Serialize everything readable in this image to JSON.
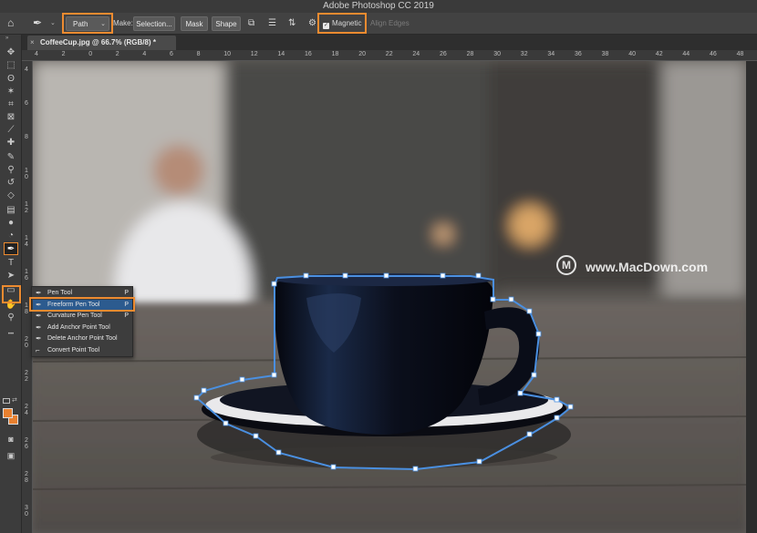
{
  "app": {
    "title": "Adobe Photoshop CC 2019"
  },
  "options_bar": {
    "mode_selected": "Path",
    "make_label": "Make:",
    "selection_button": "Selection...",
    "mask_button": "Mask",
    "shape_button": "Shape",
    "magnetic_label": "Magnetic",
    "magnetic_checked": true,
    "align_edges_label": "Align Edges",
    "highlight_color": "#ed8b30"
  },
  "document_tab": {
    "close_glyph": "×",
    "name": "CoffeeCup.jpg @ 66.7% (RGB/8) *"
  },
  "ruler": {
    "horizontal": [
      "4",
      "2",
      "0",
      "2",
      "4",
      "6",
      "8",
      "10",
      "12",
      "14",
      "16",
      "18",
      "20",
      "22",
      "24",
      "26",
      "28",
      "30",
      "32",
      "34",
      "36",
      "38",
      "40",
      "42",
      "44",
      "46",
      "48",
      "50"
    ],
    "vertical": [
      "4",
      "6",
      "8",
      "1\n0",
      "1\n2",
      "1\n4",
      "1\n6",
      "1\n8",
      "2\n0",
      "2\n2",
      "2\n4",
      "2\n6",
      "2\n8",
      "3\n0"
    ]
  },
  "toolbar": {
    "tools": [
      {
        "name": "move-tool",
        "glyph": "✥"
      },
      {
        "name": "marquee-tool",
        "glyph": "⬚"
      },
      {
        "name": "lasso-tool",
        "glyph": "ʘ"
      },
      {
        "name": "magic-wand-tool",
        "glyph": "✶"
      },
      {
        "name": "crop-tool",
        "glyph": "⌗"
      },
      {
        "name": "frame-tool",
        "glyph": "⊠"
      },
      {
        "name": "eyedropper-tool",
        "glyph": "⟋"
      },
      {
        "name": "healing-brush-tool",
        "glyph": "✚"
      },
      {
        "name": "brush-tool",
        "glyph": "✎"
      },
      {
        "name": "clone-stamp-tool",
        "glyph": "⚲"
      },
      {
        "name": "history-brush-tool",
        "glyph": "↺"
      },
      {
        "name": "eraser-tool",
        "glyph": "◇"
      },
      {
        "name": "gradient-tool",
        "glyph": "▤"
      },
      {
        "name": "blur-tool",
        "glyph": "●"
      },
      {
        "name": "dodge-tool",
        "glyph": "◔"
      },
      {
        "name": "pen-tool",
        "glyph": "✒",
        "active": true
      },
      {
        "name": "type-tool",
        "glyph": "T"
      },
      {
        "name": "path-selection-tool",
        "glyph": "➤"
      },
      {
        "name": "rectangle-tool",
        "glyph": "▭"
      },
      {
        "name": "hand-tool",
        "glyph": "✋"
      },
      {
        "name": "zoom-tool",
        "glyph": "⚲"
      },
      {
        "name": "more-tools",
        "glyph": "•••"
      }
    ],
    "foreground_color": "#e8802f",
    "background_color": "#e8802f"
  },
  "pen_flyout": {
    "items": [
      {
        "label": "Pen Tool",
        "shortcut": "P",
        "glyph": "✒",
        "selected": false
      },
      {
        "label": "Freeform Pen Tool",
        "shortcut": "P",
        "glyph": "✒",
        "selected": true
      },
      {
        "label": "Curvature Pen Tool",
        "shortcut": "P",
        "glyph": "✒",
        "selected": false
      },
      {
        "label": "Add Anchor Point Tool",
        "shortcut": "",
        "glyph": "✒",
        "selected": false
      },
      {
        "label": "Delete Anchor Point Tool",
        "shortcut": "",
        "glyph": "✒",
        "selected": false
      },
      {
        "label": "Convert Point Tool",
        "shortcut": "",
        "glyph": "⌐",
        "selected": false
      }
    ]
  },
  "watermark": {
    "logo": "M",
    "text": "www.MacDown.com"
  }
}
